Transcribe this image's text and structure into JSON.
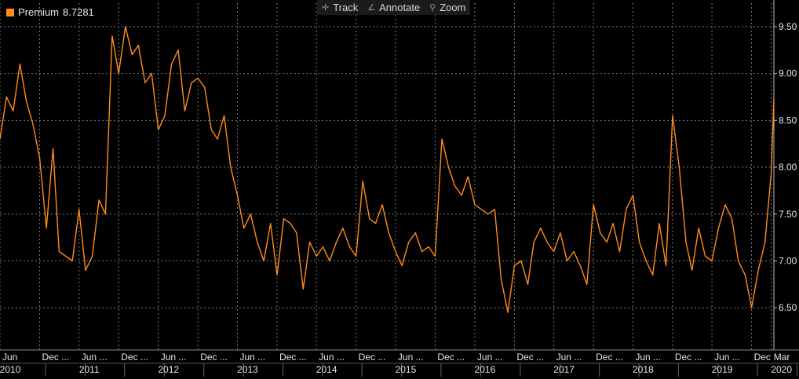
{
  "toolbar": {
    "track_label": "Track",
    "annotate_label": "Annotate",
    "zoom_label": "Zoom"
  },
  "legend": {
    "series_name": "Premium",
    "last_value": "8.7281"
  },
  "colors": {
    "line": "#ff8c1a",
    "grid": "#7a7a7a",
    "background": "#000000",
    "text": "#e6e6e6"
  },
  "chart_data": {
    "type": "line",
    "title": "",
    "xlabel": "",
    "ylabel": "",
    "x_range": [
      "2010-06-01",
      "2020-03-13"
    ],
    "ylim": [
      6.05,
      9.75
    ],
    "grid": true,
    "y_axis_position": "right",
    "y_ticks": [
      "6.50",
      "7.00",
      "7.50",
      "8.00",
      "8.50",
      "9.00",
      "9.50"
    ],
    "x_ticks": [
      {
        "label": "Jun",
        "date": "2010-06-01",
        "year": "2010"
      },
      {
        "label": "Dec ...",
        "date": "2010-12-01",
        "year": ""
      },
      {
        "label": "Jun ...",
        "date": "2011-06-01",
        "year": "2011"
      },
      {
        "label": "Dec ...",
        "date": "2011-12-01",
        "year": ""
      },
      {
        "label": "Jun ...",
        "date": "2012-06-01",
        "year": "2012"
      },
      {
        "label": "Dec ...",
        "date": "2012-12-01",
        "year": ""
      },
      {
        "label": "Jun ...",
        "date": "2013-06-01",
        "year": "2013"
      },
      {
        "label": "Dec ...",
        "date": "2013-12-01",
        "year": ""
      },
      {
        "label": "Jun ...",
        "date": "2014-06-01",
        "year": "2014"
      },
      {
        "label": "Dec ...",
        "date": "2014-12-01",
        "year": ""
      },
      {
        "label": "Jun ...",
        "date": "2015-06-01",
        "year": "2015"
      },
      {
        "label": "Dec ...",
        "date": "2015-12-01",
        "year": ""
      },
      {
        "label": "Jun ...",
        "date": "2016-06-01",
        "year": "2016"
      },
      {
        "label": "Dec ...",
        "date": "2016-12-01",
        "year": ""
      },
      {
        "label": "Jun ...",
        "date": "2017-06-01",
        "year": "2017"
      },
      {
        "label": "Dec ...",
        "date": "2017-12-01",
        "year": ""
      },
      {
        "label": "Jun ...",
        "date": "2018-06-01",
        "year": "2018"
      },
      {
        "label": "Dec ...",
        "date": "2018-12-01",
        "year": ""
      },
      {
        "label": "Jun ...",
        "date": "2019-06-01",
        "year": "2019"
      },
      {
        "label": "Dec",
        "date": "2019-12-01",
        "year": ""
      },
      {
        "label": "Mar",
        "date": "2020-03-01",
        "year": "2020"
      }
    ],
    "series": [
      {
        "name": "Premium",
        "x": [
          "2010-06-01",
          "2010-07-01",
          "2010-08-01",
          "2010-09-01",
          "2010-10-01",
          "2010-11-01",
          "2010-12-01",
          "2011-01-01",
          "2011-02-01",
          "2011-03-01",
          "2011-04-01",
          "2011-05-01",
          "2011-06-01",
          "2011-07-01",
          "2011-08-01",
          "2011-09-01",
          "2011-10-01",
          "2011-11-01",
          "2011-12-01",
          "2012-01-01",
          "2012-02-01",
          "2012-03-01",
          "2012-04-01",
          "2012-05-01",
          "2012-06-01",
          "2012-07-01",
          "2012-08-01",
          "2012-09-01",
          "2012-10-01",
          "2012-11-01",
          "2012-12-01",
          "2013-01-01",
          "2013-02-01",
          "2013-03-01",
          "2013-04-01",
          "2013-05-01",
          "2013-06-01",
          "2013-07-01",
          "2013-08-01",
          "2013-09-01",
          "2013-10-01",
          "2013-11-01",
          "2013-12-01",
          "2014-01-01",
          "2014-02-01",
          "2014-03-01",
          "2014-04-01",
          "2014-05-01",
          "2014-06-01",
          "2014-07-01",
          "2014-08-01",
          "2014-09-01",
          "2014-10-01",
          "2014-11-01",
          "2014-12-01",
          "2015-01-01",
          "2015-02-01",
          "2015-03-01",
          "2015-04-01",
          "2015-05-01",
          "2015-06-01",
          "2015-07-01",
          "2015-08-01",
          "2015-09-01",
          "2015-10-01",
          "2015-11-01",
          "2015-12-01",
          "2016-01-01",
          "2016-02-01",
          "2016-03-01",
          "2016-04-01",
          "2016-05-01",
          "2016-06-01",
          "2016-07-01",
          "2016-08-01",
          "2016-09-01",
          "2016-10-01",
          "2016-11-01",
          "2016-12-01",
          "2017-01-01",
          "2017-02-01",
          "2017-03-01",
          "2017-04-01",
          "2017-05-01",
          "2017-06-01",
          "2017-07-01",
          "2017-08-01",
          "2017-09-01",
          "2017-10-01",
          "2017-11-01",
          "2017-12-01",
          "2018-01-01",
          "2018-02-01",
          "2018-03-01",
          "2018-04-01",
          "2018-05-01",
          "2018-06-01",
          "2018-07-01",
          "2018-08-01",
          "2018-09-01",
          "2018-10-01",
          "2018-11-01",
          "2018-12-01",
          "2019-01-01",
          "2019-02-01",
          "2019-03-01",
          "2019-04-01",
          "2019-05-01",
          "2019-06-01",
          "2019-07-01",
          "2019-08-01",
          "2019-09-01",
          "2019-10-01",
          "2019-11-01",
          "2019-12-01",
          "2020-01-01",
          "2020-02-01",
          "2020-03-01",
          "2020-03-13"
        ],
        "y": [
          8.3,
          8.75,
          8.6,
          9.1,
          8.7,
          8.45,
          8.1,
          7.35,
          8.2,
          7.1,
          7.05,
          7.0,
          7.55,
          6.9,
          7.05,
          7.65,
          7.5,
          9.4,
          9.0,
          9.5,
          9.2,
          9.3,
          8.9,
          9.0,
          8.4,
          8.55,
          9.1,
          9.25,
          8.6,
          8.9,
          8.95,
          8.85,
          8.4,
          8.3,
          8.55,
          8.0,
          7.7,
          7.35,
          7.5,
          7.2,
          7.0,
          7.4,
          6.85,
          7.45,
          7.4,
          7.3,
          6.7,
          7.2,
          7.05,
          7.15,
          7.0,
          7.2,
          7.35,
          7.15,
          7.05,
          7.85,
          7.45,
          7.4,
          7.6,
          7.3,
          7.1,
          6.95,
          7.2,
          7.3,
          7.1,
          7.15,
          7.05,
          8.3,
          8.0,
          7.8,
          7.7,
          7.9,
          7.6,
          7.55,
          7.5,
          7.55,
          6.8,
          6.45,
          6.95,
          7.0,
          6.75,
          7.2,
          7.35,
          7.2,
          7.1,
          7.3,
          7.0,
          7.1,
          6.95,
          6.75,
          7.6,
          7.3,
          7.2,
          7.4,
          7.1,
          7.55,
          7.7,
          7.2,
          7.0,
          6.85,
          7.4,
          6.95,
          8.55,
          8.0,
          7.2,
          6.9,
          7.35,
          7.05,
          7.0,
          7.35,
          7.6,
          7.45,
          7.0,
          6.85,
          6.5,
          6.9,
          7.2,
          7.95,
          8.73
        ]
      }
    ]
  }
}
